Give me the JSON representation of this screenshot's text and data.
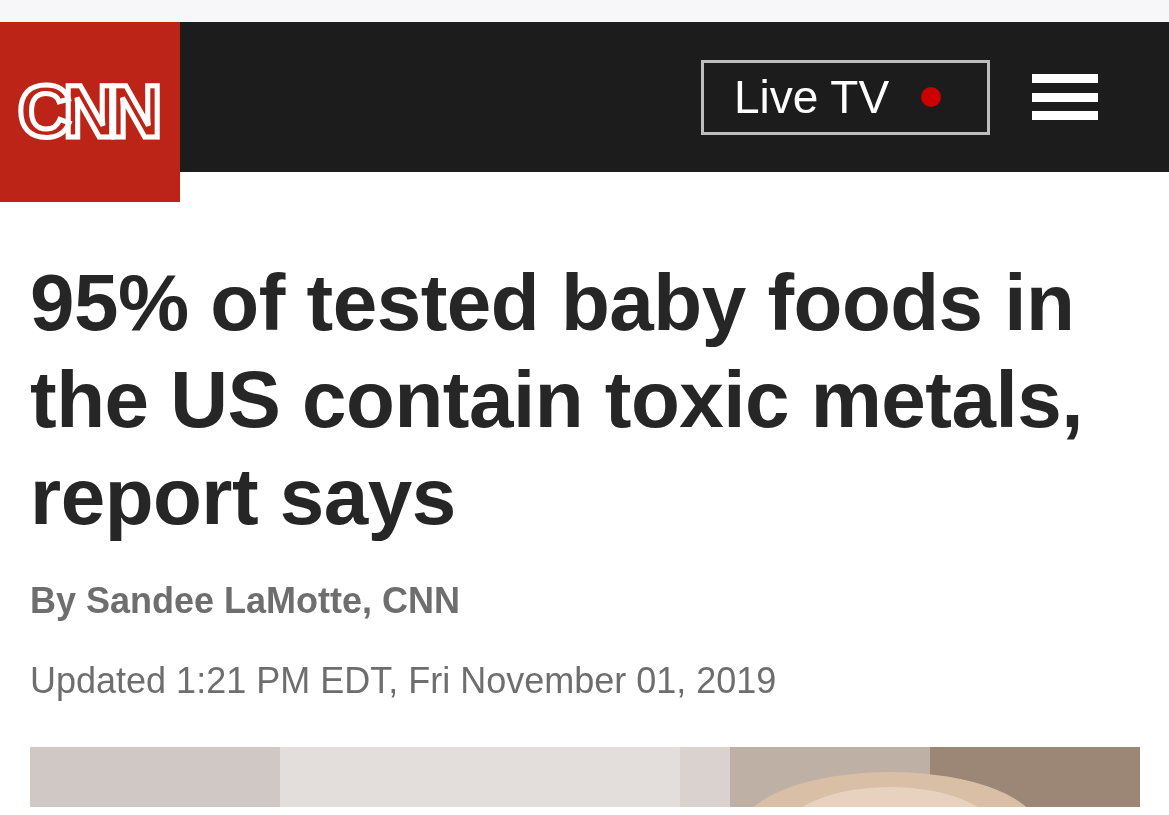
{
  "header": {
    "logo": "CNN",
    "live_tv": {
      "label": "Live TV",
      "live": true
    }
  },
  "article": {
    "headline": "95% of tested baby foods in the US contain toxic metals, report says",
    "byline": "By Sandee LaMotte, CNN",
    "updated": "Updated 1:21 PM EDT, Fri November 01, 2019"
  }
}
